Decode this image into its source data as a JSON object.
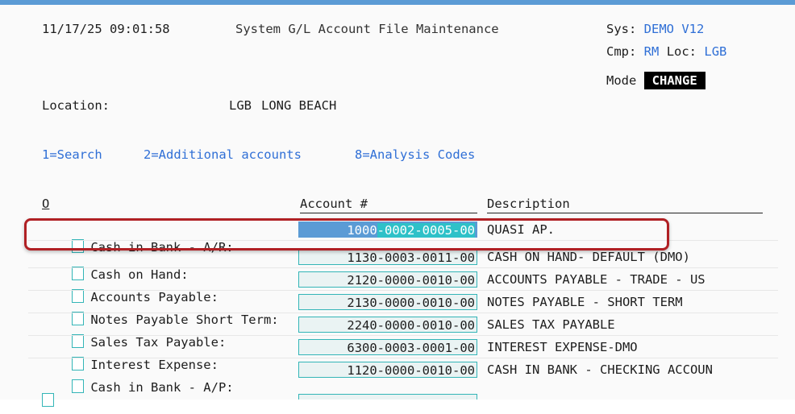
{
  "header": {
    "datetime": "11/17/25 09:01:58",
    "title": "System G/L Account File Maintenance",
    "sys_label": "Sys:",
    "sys_value": "DEMO V12",
    "cmp_label": "Cmp:",
    "cmp_value": "RM",
    "loc_label": "Loc:",
    "loc_value": "LGB",
    "mode_label": "Mode",
    "mode_value": "CHANGE"
  },
  "location": {
    "label": "Location:",
    "code": "LGB",
    "name": "LONG BEACH"
  },
  "function_keys": [
    {
      "label": "1=Search"
    },
    {
      "label": "2=Additional accounts"
    },
    {
      "label": "8=Analysis Codes"
    }
  ],
  "columns": {
    "option": "O",
    "account": "Account #",
    "description": "Description"
  },
  "rows": [
    {
      "label": "Cash in Bank - A/R:",
      "account_seg1": "1000",
      "account_rest": "-0002-0005-00",
      "description": "QUASI AP.",
      "selected": true
    },
    {
      "label": "Cash on Hand:",
      "account": "1130-0003-0011-00",
      "description": "CASH ON HAND- DEFAULT (DMO)"
    },
    {
      "label": "Accounts Payable:",
      "account": "2120-0000-0010-00",
      "description": "ACCOUNTS PAYABLE - TRADE - US"
    },
    {
      "label": "Notes Payable Short Term:",
      "account": "2130-0000-0010-00",
      "description": "NOTES PAYABLE - SHORT TERM"
    },
    {
      "label": "Sales Tax Payable:",
      "account": "2240-0000-0010-00",
      "description": "SALES TAX PAYABLE"
    },
    {
      "label": "Interest Expense:",
      "account": "6300-0003-0001-00",
      "description": "INTEREST EXPENSE-DMO"
    },
    {
      "label": "Cash in Bank - A/P:",
      "account": "1120-0000-0010-00",
      "description": "CASH IN BANK - CHECKING ACCOUN"
    }
  ],
  "colors": {
    "accent": "#5b9bd5",
    "field_border": "#33b5b7",
    "highlight": "#b02024",
    "link": "#2f6fd6"
  }
}
